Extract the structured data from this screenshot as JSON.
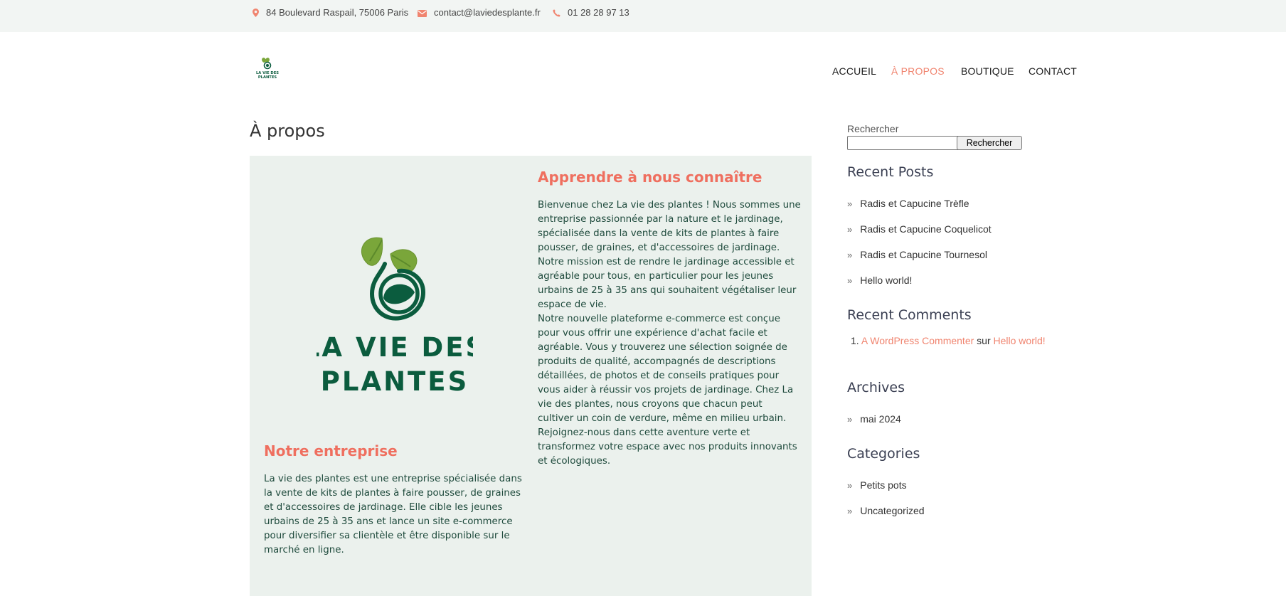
{
  "topbar": {
    "address": "84 Boulevard Raspail, 75006 Paris",
    "email": "contact@laviedesplante.fr",
    "phone": "01 28 28 97 13"
  },
  "logo": {
    "line1": "LA VIE DES",
    "line2": "PLANTES"
  },
  "nav": [
    {
      "label": "ACCUEIL",
      "active": false
    },
    {
      "label": "À PROPOS",
      "active": true
    },
    {
      "label": "BOUTIQUE",
      "active": false
    },
    {
      "label": "CONTACT",
      "active": false
    }
  ],
  "page_title": "À propos",
  "content": {
    "about_heading": "Apprendre à nous connaître",
    "about_p1": "Bienvenue chez La vie des plantes ! Nous sommes une entreprise passionnée par la nature et le jardinage, spécialisée dans la vente de kits de plantes à faire pousser, de graines, et d'accessoires de jardinage. Notre mission est de rendre le jardinage accessible et agréable pour tous, en particulier pour les jeunes urbains de 25 à 35 ans qui souhaitent végétaliser leur espace de vie.",
    "about_p2": "Notre nouvelle plateforme e-commerce est conçue pour vous offrir une expérience d'achat facile et agréable. Vous y trouverez une sélection soignée de produits de qualité, accompagnés de descriptions détaillées, de photos et de conseils pratiques pour vous aider à réussir vos projets de jardinage. Chez La vie des plantes, nous croyons que chacun peut cultiver un coin de verdure, même en milieu urbain. Rejoignez-nous dans cette aventure verte et transformez votre espace avec nos produits innovants et écologiques.",
    "company_heading": "Notre entreprise",
    "company_p": "La vie des plantes est une entreprise spécialisée dans la vente de kits de plantes à faire pousser, de graines et d'accessoires de jardinage. Elle cible les jeunes urbains de 25 à 35 ans et lance un site e-commerce pour diversifier sa clientèle et être disponible sur le marché en ligne."
  },
  "sidebar": {
    "search_label": "Rechercher",
    "search_value": "",
    "search_button": "Rechercher",
    "recent_posts_title": "Recent Posts",
    "recent_posts": [
      "Radis et Capucine Trèfle",
      "Radis et Capucine Coquelicot",
      "Radis et Capucine Tournesol",
      "Hello world!"
    ],
    "recent_comments_title": "Recent Comments",
    "comment": {
      "number": "1.",
      "author": "A WordPress Commenter",
      "sep": "sur",
      "post": "Hello world!"
    },
    "archives_title": "Archives",
    "archives": [
      "mai 2024"
    ],
    "categories_title": "Categories",
    "categories": [
      "Petits pots",
      "Uncategorized"
    ]
  },
  "colors": {
    "accent": "#f0846f",
    "heading_pink": "#ef6f5f",
    "dark_green": "#0b5c3e",
    "leaf_green": "#7aa63a",
    "box_bg": "#ebf1ed",
    "topbar_bg": "#f2f5f3"
  }
}
